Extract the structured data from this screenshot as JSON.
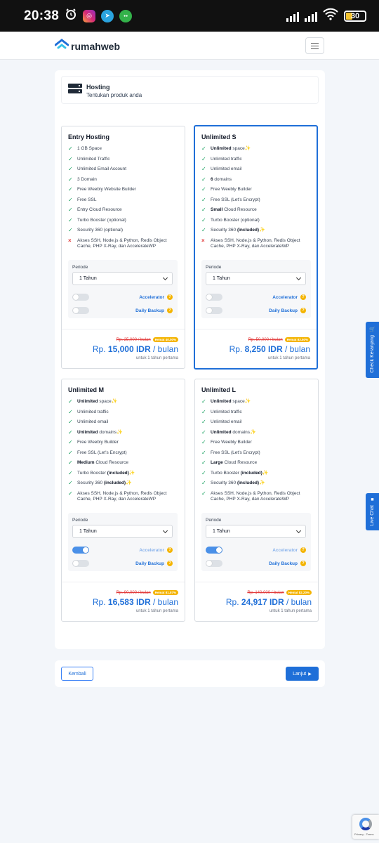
{
  "status_bar": {
    "time": "20:38",
    "battery": "30",
    "icons": [
      "alarm-icon",
      "instagram-icon",
      "telegram-icon",
      "app-icon",
      "signal-icon",
      "wifi-icon",
      "battery-icon"
    ]
  },
  "brand": {
    "name": "rumahweb",
    "color": "#1f6fd8"
  },
  "header": {
    "title": "Hosting",
    "subtitle": "Tentukan produk anda"
  },
  "plans": [
    {
      "name": "Entry Hosting",
      "features": [
        {
          "t": "1 GB Space"
        },
        {
          "t": "Unlimited Traffic"
        },
        {
          "t": "Unlimited Email Account"
        },
        {
          "t": "3 Domain"
        },
        {
          "t": "Free Weebly Website Builder"
        },
        {
          "t": "Free SSL"
        },
        {
          "t": "Entry Cloud Resource"
        },
        {
          "t": "Turbo Booster (optional)"
        },
        {
          "t": "Security 360 (optional)"
        },
        {
          "t": "Akses SSH, Node.js & Python, Redis Object Cache, PHP X-Ray, dan AccelerateWP",
          "no": true
        }
      ],
      "periode_label": "Periode",
      "periode": "1 Tahun",
      "accelerator_label": "Accelerator",
      "backup_label": "Daily Backup",
      "accelerator_on": false,
      "backup_on": false,
      "old_price": "Rp. 25,000 / bulan",
      "discount": "Hemat 40.00%",
      "price_prefix": "Rp.",
      "price_amount": "15,000 IDR",
      "price_suffix": "/ bulan",
      "price_note": "untuk 1 tahun pertama"
    },
    {
      "name": "Unlimited S",
      "selected": true,
      "features": [
        {
          "b": "Unlimited",
          "t": " space",
          "spark": true
        },
        {
          "t": "Unlimited traffic"
        },
        {
          "t": "Unlimited email"
        },
        {
          "b": "6",
          "t": " domains"
        },
        {
          "t": "Free Weebly Builder"
        },
        {
          "t": "Free SSL (Let's Encrypt)"
        },
        {
          "b": "Small",
          "t": "  Cloud Resource"
        },
        {
          "t": "Turbo Booster (optional)"
        },
        {
          "t": "Security 360 ",
          "b2": "(included)",
          "spark": true
        },
        {
          "t": "Akses SSH, Node.js & Python, Redis Object Cache, PHP X-Ray, dan AccelerateWP",
          "no": true
        }
      ],
      "periode_label": "Periode",
      "periode": "1 Tahun",
      "accelerator_label": "Accelerator",
      "backup_label": "Daily Backup",
      "accelerator_on": false,
      "backup_on": false,
      "old_price": "Rp. 50,000 / bulan",
      "discount": "Hemat 83.50%",
      "price_prefix": "Rp.",
      "price_amount": "8,250 IDR",
      "price_suffix": "/ bulan",
      "price_note": "untuk 1 tahun pertama"
    },
    {
      "name": "Unlimited M",
      "features": [
        {
          "b": "Unlimited",
          "t": " space",
          "spark": true
        },
        {
          "t": "Unlimited traffic"
        },
        {
          "t": "Unlimited email"
        },
        {
          "b": "Unlimited",
          "t": " domains",
          "spark": true
        },
        {
          "t": "Free Weebly Builder"
        },
        {
          "t": "Free SSL (Let's Encrypt)"
        },
        {
          "b": "Medium",
          "t": "  Cloud Resource"
        },
        {
          "t": "Turbo Booster ",
          "b2": "(included)",
          "spark": true
        },
        {
          "t": "Security 360 ",
          "b2": "(included)",
          "spark": true
        },
        {
          "t": "Akses SSH, Node.js & Python, Redis Object Cache, PHP X-Ray, dan AccelerateWP"
        }
      ],
      "periode_label": "Periode",
      "periode": "1 Tahun",
      "accelerator_label": "Accelerator",
      "backup_label": "Daily Backup",
      "accelerator_on": true,
      "backup_on": false,
      "old_price": "Rp. 90,000 / bulan",
      "discount": "Hemat 81.57%",
      "price_prefix": "Rp.",
      "price_amount": "16,583 IDR",
      "price_suffix": "/ bulan",
      "price_note": "untuk 1 tahun pertama"
    },
    {
      "name": "Unlimited L",
      "features": [
        {
          "b": "Unlimited",
          "t": " space",
          "spark": true
        },
        {
          "t": "Unlimited traffic"
        },
        {
          "t": "Unlimited email"
        },
        {
          "b": "Unlimited",
          "t": " domains",
          "spark": true
        },
        {
          "t": "Free Weebly Builder"
        },
        {
          "t": "Free SSL (Let's Encrypt)"
        },
        {
          "b": "Large",
          "t": " Cloud Resource"
        },
        {
          "t": "Turbo Booster ",
          "b2": "(included)",
          "spark": true
        },
        {
          "t": "Security 360 ",
          "b2": "(included)",
          "spark": true
        },
        {
          "t": "Akses SSH, Node.js & Python, Redis Object Cache, PHP X-Ray, dan AccelerateWP"
        }
      ],
      "periode_label": "Periode",
      "periode": "1 Tahun",
      "accelerator_label": "Accelerator",
      "backup_label": "Daily Backup",
      "accelerator_on": true,
      "backup_on": false,
      "old_price": "Rp. 140,000 / bulan",
      "discount": "Hemat 82.20%",
      "price_prefix": "Rp.",
      "price_amount": "24,917 IDR",
      "price_suffix": "/ bulan",
      "price_note": "untuk 1 tahun pertama"
    }
  ],
  "footer": {
    "back": "Kembali",
    "next": "Lanjut"
  },
  "side_tabs": {
    "check": "Check Keranjang",
    "chat": "Live Chat"
  },
  "recaptcha": {
    "text": "Privacy - Terms"
  }
}
